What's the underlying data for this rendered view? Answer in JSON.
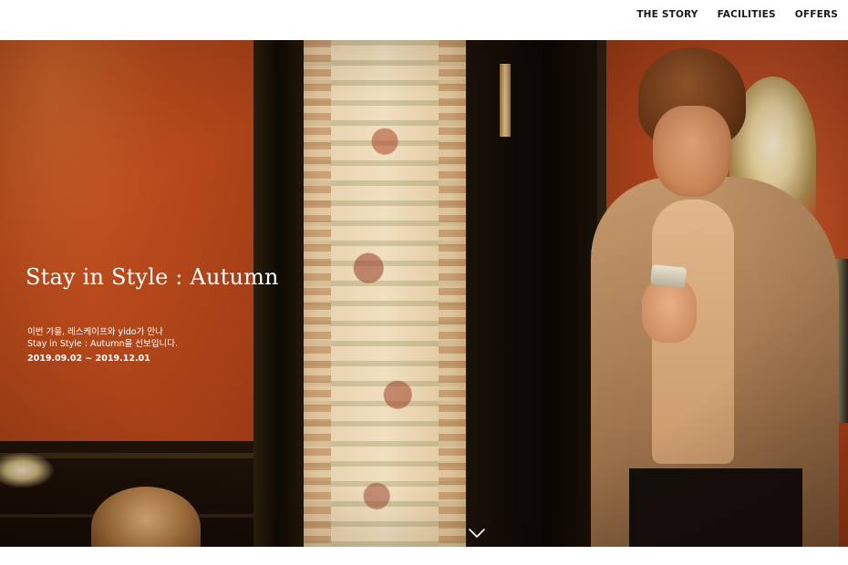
{
  "nav": {
    "items": [
      {
        "label": "THE STORY"
      },
      {
        "label": "FACILITIES"
      },
      {
        "label": "OFFERS"
      }
    ]
  },
  "hero": {
    "title": "Stay in Style : Autumn",
    "description_lines": [
      "이번 가을, 레스케이프와 yido가 만나",
      "Stay in Style : Autumn을 선보입니다."
    ],
    "dates": "2019.09.02 ~ 2019.12.01",
    "scroll_icon": "chevron-down-icon"
  },
  "colors": {
    "nav_text": "#1a1a1a",
    "hero_text": "#ffffff",
    "wall_orange": "#b94b1c"
  }
}
